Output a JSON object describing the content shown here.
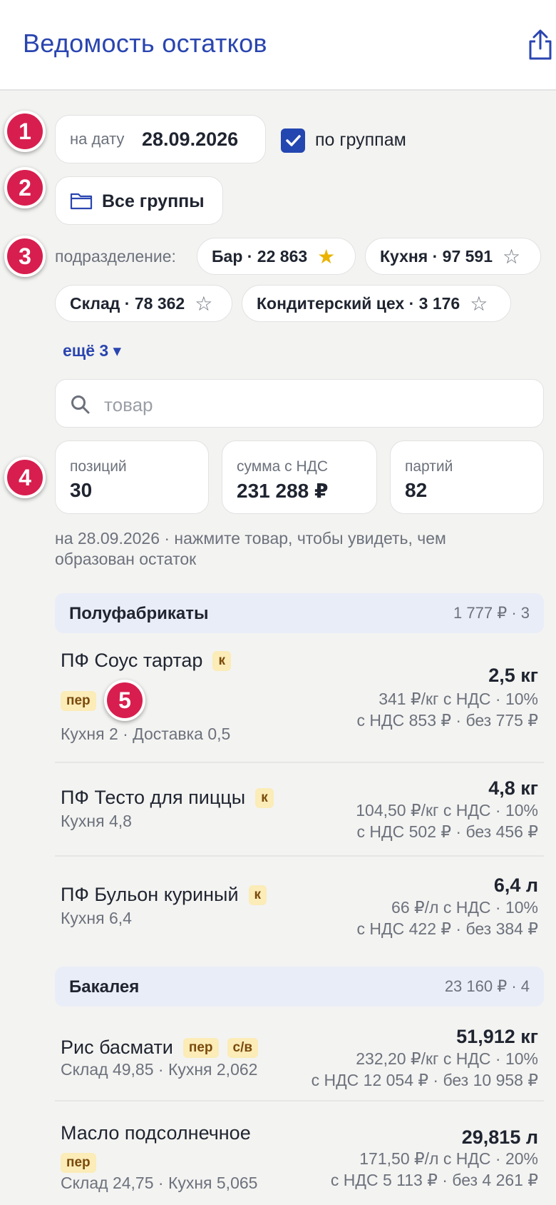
{
  "header": {
    "title": "Ведомость остатков",
    "share_icon": "share-icon"
  },
  "annotations": [
    "1",
    "2",
    "3",
    "4",
    "5"
  ],
  "filters": {
    "date_label": "на дату",
    "date_value": "28.09.2026",
    "by_groups_label": "по группам",
    "by_groups_checked": true,
    "groups_button": "Все группы",
    "division_label": "подразделение:",
    "divisions": [
      {
        "label": "Бар · 22 863",
        "starred": true,
        "star": "★"
      },
      {
        "label": "Кухня · 97 591",
        "starred": false,
        "star": "☆"
      },
      {
        "label": "Склад · 78 362",
        "starred": false,
        "star": "☆"
      },
      {
        "label": "Кондитерский цех · 3 176",
        "starred": false,
        "star": "☆"
      }
    ],
    "more_label": "ещё 3 ▾",
    "search_placeholder": "товар"
  },
  "stats": [
    {
      "label": "позиций",
      "value": "30"
    },
    {
      "label": "сумма с НДС",
      "value": "231 288 ₽"
    },
    {
      "label": "партий",
      "value": "82"
    }
  ],
  "hint_line1": "на 28.09.2026 · нажмите товар, чтобы увидеть, чем",
  "hint_line2": "образован остаток",
  "groups": [
    {
      "name": "Полуфабрикаты",
      "summary": "1 777 ₽ · 3",
      "items": [
        {
          "name": "ПФ Соус тартар",
          "tags": [
            "к"
          ],
          "extra_tag": "пер",
          "sub": "Кухня 2 · Доставка 0,5",
          "qty": "2,5 кг",
          "price": "341 ₽/кг с НДС · 10%",
          "totals": "с НДС 853 ₽ · без 775 ₽"
        },
        {
          "name": "ПФ Тесто для пиццы",
          "tags": [
            "к"
          ],
          "sub": "Кухня 4,8",
          "qty": "4,8 кг",
          "price": "104,50 ₽/кг с НДС · 10%",
          "totals": "с НДС 502 ₽ · без 456 ₽"
        },
        {
          "name": "ПФ Бульон куриный",
          "tags": [
            "к"
          ],
          "sub": "Кухня 6,4",
          "qty": "6,4 л",
          "price": "66 ₽/л с НДС · 10%",
          "totals": "с НДС 422 ₽ · без 384 ₽"
        }
      ]
    },
    {
      "name": "Бакалея",
      "summary": "23 160 ₽ · 4",
      "items": [
        {
          "name": "Рис басмати",
          "tags": [
            "пер",
            "с/в"
          ],
          "sub": "Склад 49,85 · Кухня 2,062",
          "qty": "51,912 кг",
          "price": "232,20 ₽/кг с НДС · 10%",
          "totals": "с НДС 12 054 ₽ · без 10 958 ₽"
        },
        {
          "name": "Масло подсолнечное",
          "tags": [],
          "extra_tag": "пер",
          "sub": "Склад 24,75 · Кухня 5,065",
          "qty": "29,815 л",
          "price": "171,50 ₽/л с НДС · 20%",
          "totals": "с НДС 5 113 ₽ · без 4 261 ₽"
        }
      ]
    }
  ],
  "colors": {
    "accent": "#2a45b0",
    "badge": "#d81e4e",
    "tag_bg": "#fbecb8",
    "group_bg": "#e9edf8",
    "star_active": "#e9b300"
  }
}
